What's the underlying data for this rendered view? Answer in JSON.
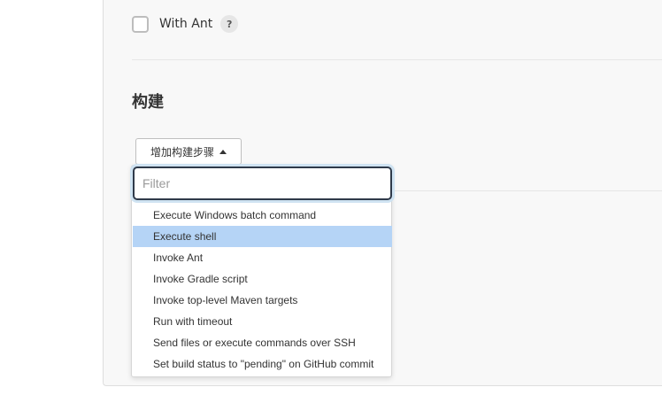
{
  "with_ant": {
    "label": "With Ant",
    "checked": false,
    "help_text": "?"
  },
  "build_section": {
    "title": "构建",
    "add_step_label": "增加构建步骤",
    "caret": "up-caret-icon"
  },
  "dropdown": {
    "filter_placeholder": "Filter",
    "filter_value": "",
    "selected_index": 1,
    "selected_color": "#b5d4f6",
    "items": [
      {
        "label": "Execute Windows batch command"
      },
      {
        "label": "Execute shell"
      },
      {
        "label": "Invoke Ant"
      },
      {
        "label": "Invoke Gradle script"
      },
      {
        "label": "Invoke top-level Maven targets"
      },
      {
        "label": "Run with timeout"
      },
      {
        "label": "Send files or execute commands over SSH"
      },
      {
        "label": "Set build status to \"pending\" on GitHub commit"
      }
    ]
  }
}
